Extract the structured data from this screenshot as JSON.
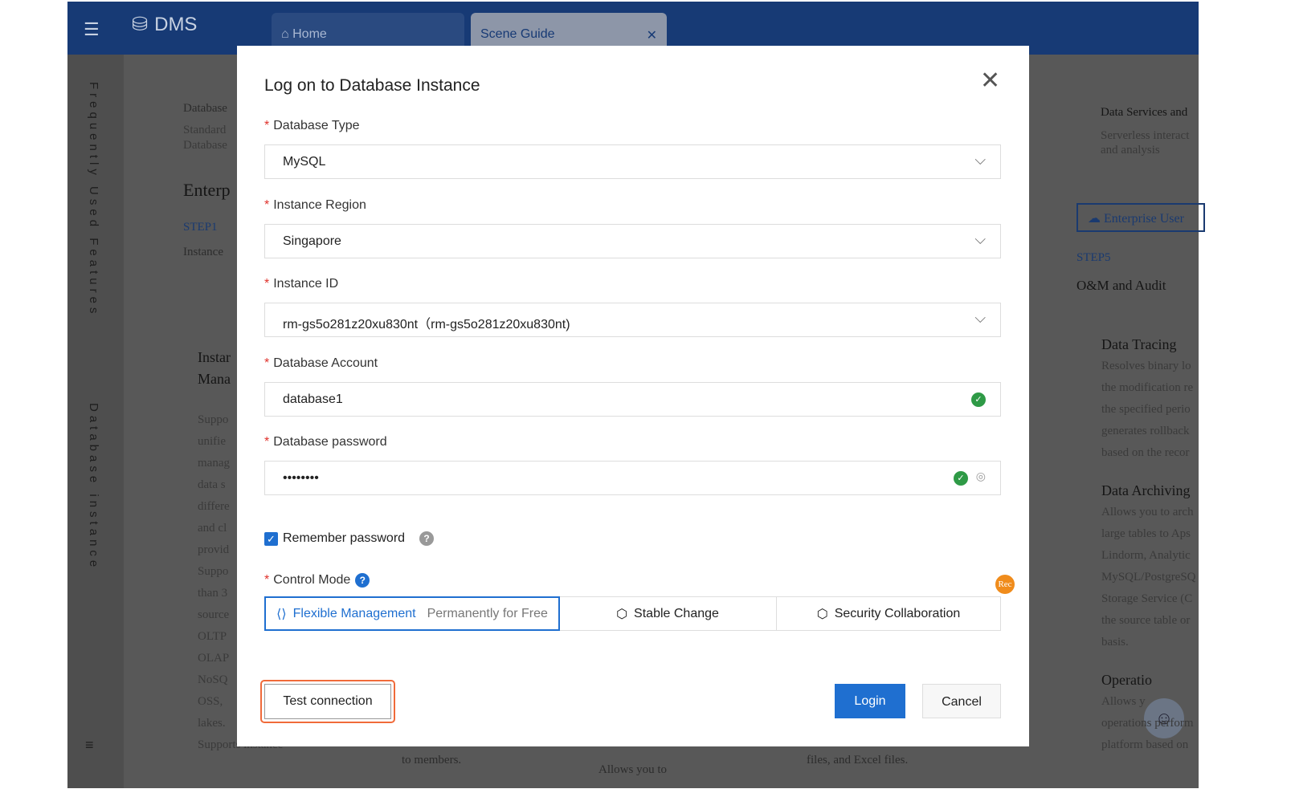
{
  "app": {
    "brand": "DMS",
    "tabs": [
      {
        "label": "Home"
      },
      {
        "label": "Scene Guide"
      }
    ],
    "sidebar": {
      "vertical_labels": [
        "Frequently Used Features",
        "Database instance"
      ]
    },
    "background": {
      "left": [
        "Database",
        "Standard",
        "Database",
        "Enterp",
        "STEP1",
        "Instance",
        "Instar",
        "Mana",
        "Suppo",
        "unifie",
        "manag",
        "data s",
        "differe",
        "and cl",
        "provid",
        "Suppo",
        "than 3",
        "source",
        "OLTP",
        "OLAP",
        "NoSQ",
        "OSS,",
        "lakes.",
        "Supports instance-"
      ],
      "mid": [
        "to members.",
        "Allows you to",
        "files, and Excel files."
      ],
      "right": {
        "title": "Data Services and",
        "desc1": "Serverless interact",
        "desc2": "and analysis",
        "enterprise_button": "Enterprise User",
        "step": "STEP5",
        "step_title": "O&M and Audit",
        "sections": [
          {
            "title": "Data Tracing",
            "lines": [
              "Resolves binary lo",
              "the modification re",
              "the specified perio",
              "generates rollback",
              "based on the recor"
            ]
          },
          {
            "title": "Data Archiving",
            "lines": [
              "Allows you to arch",
              "large tables to Aps",
              "Lindorm, Analytic",
              "MySQL/PostgreSQ",
              "Storage Service (C",
              "the source table or",
              "basis."
            ]
          },
          {
            "title": "Operatio",
            "lines": [
              "Allows y",
              "operations perform",
              "platform based on"
            ]
          }
        ]
      }
    }
  },
  "dialog": {
    "title": "Log on to Database Instance",
    "fields": [
      {
        "label": "Database Type",
        "value": "MySQL",
        "type": "select"
      },
      {
        "label": "Instance Region",
        "value": "Singapore",
        "type": "select"
      },
      {
        "label": "Instance ID",
        "value": "rm-gs5o281z20xu830nt（rm-gs5o281z20xu830nt)",
        "type": "select"
      },
      {
        "label": "Database Account",
        "value": "database1",
        "type": "text",
        "valid": true
      },
      {
        "label": "Database password",
        "value": "••••••••",
        "type": "password",
        "valid": true
      }
    ],
    "remember_password": {
      "label": "Remember password",
      "checked": true
    },
    "control_mode": {
      "label": "Control Mode",
      "options": [
        {
          "label": "Flexible Management",
          "sub": "Permanently for Free",
          "selected": true
        },
        {
          "label": "Stable Change",
          "selected": false
        },
        {
          "label": "Security Collaboration",
          "selected": false,
          "badge": "Rec"
        }
      ]
    },
    "buttons": {
      "test": "Test connection",
      "login": "Login",
      "cancel": "Cancel"
    }
  },
  "colors": {
    "primary": "#1f6fd0",
    "header": "#1a4fa0",
    "success": "#2e9a46",
    "highlight": "#f06a3a",
    "badge": "#f08c1c"
  }
}
